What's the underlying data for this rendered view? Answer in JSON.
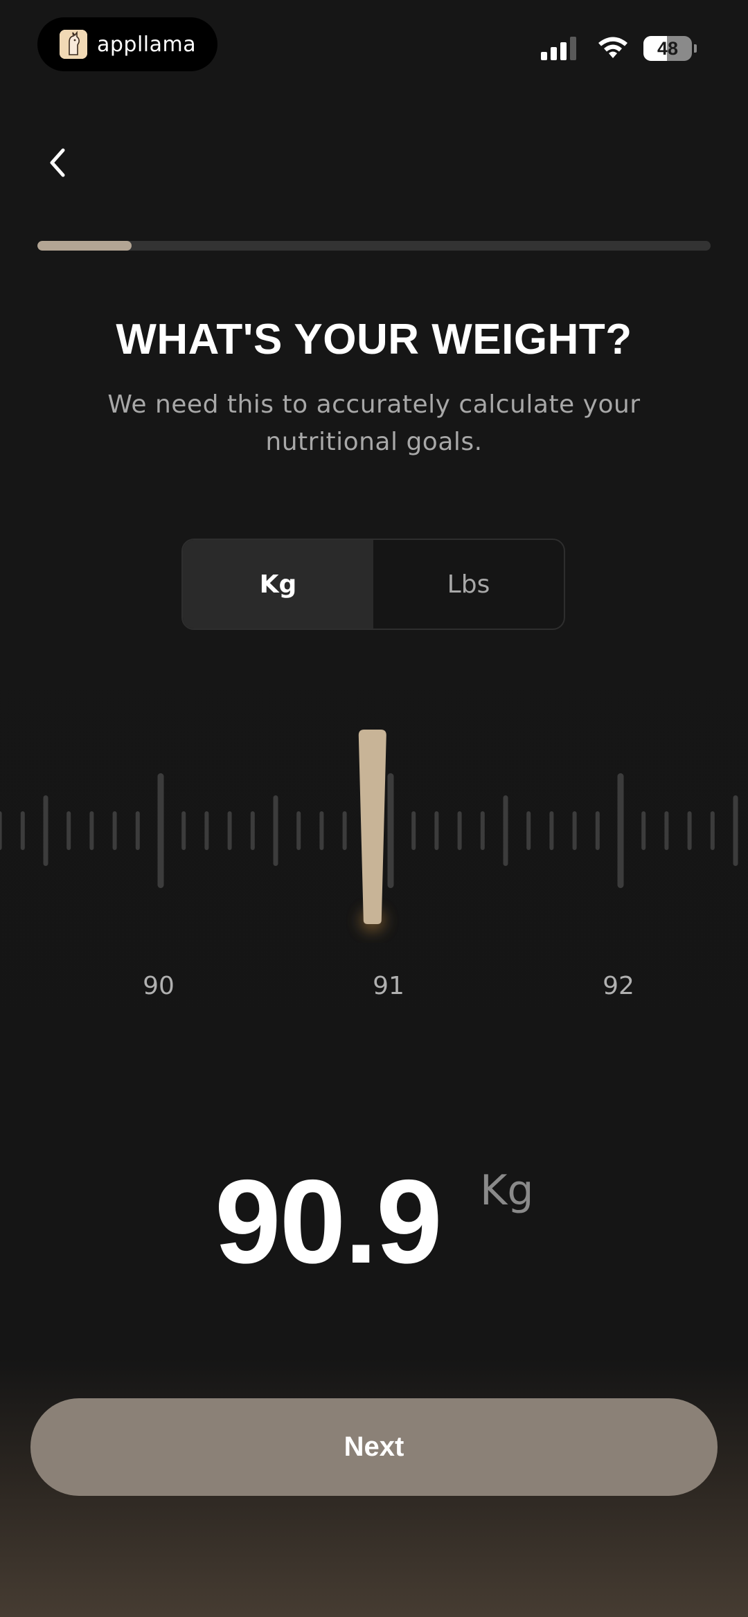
{
  "status_bar": {
    "app_name": "appllama",
    "battery": "48",
    "battery_level": 0.48,
    "icons": [
      "llama-icon",
      "signal-icon",
      "wifi-icon",
      "battery-icon"
    ]
  },
  "nav": {
    "back_icon": "chevron-left-icon"
  },
  "progress": {
    "value": 0.14
  },
  "header": {
    "title": "WHAT'S YOUR WEIGHT?",
    "subtitle": "We need this to accurately calculate your nutritional goals."
  },
  "unit_toggle": {
    "options": [
      {
        "label": "Kg",
        "selected": true
      },
      {
        "label": "Lbs",
        "selected": false
      }
    ]
  },
  "ruler": {
    "min_visible": 88.7,
    "max_visible": 92.5,
    "step": 0.1,
    "major_every": 0.5,
    "labels": [
      "90",
      "91",
      "92"
    ],
    "label_values": [
      90,
      91,
      92
    ],
    "selected_value": 90.9,
    "accent_color": "#c8b497",
    "tick_color": "#3c3c3c"
  },
  "readout": {
    "value": "90.9",
    "unit": "Kg"
  },
  "footer": {
    "next_label": "Next",
    "button_color": "#8b8177"
  }
}
